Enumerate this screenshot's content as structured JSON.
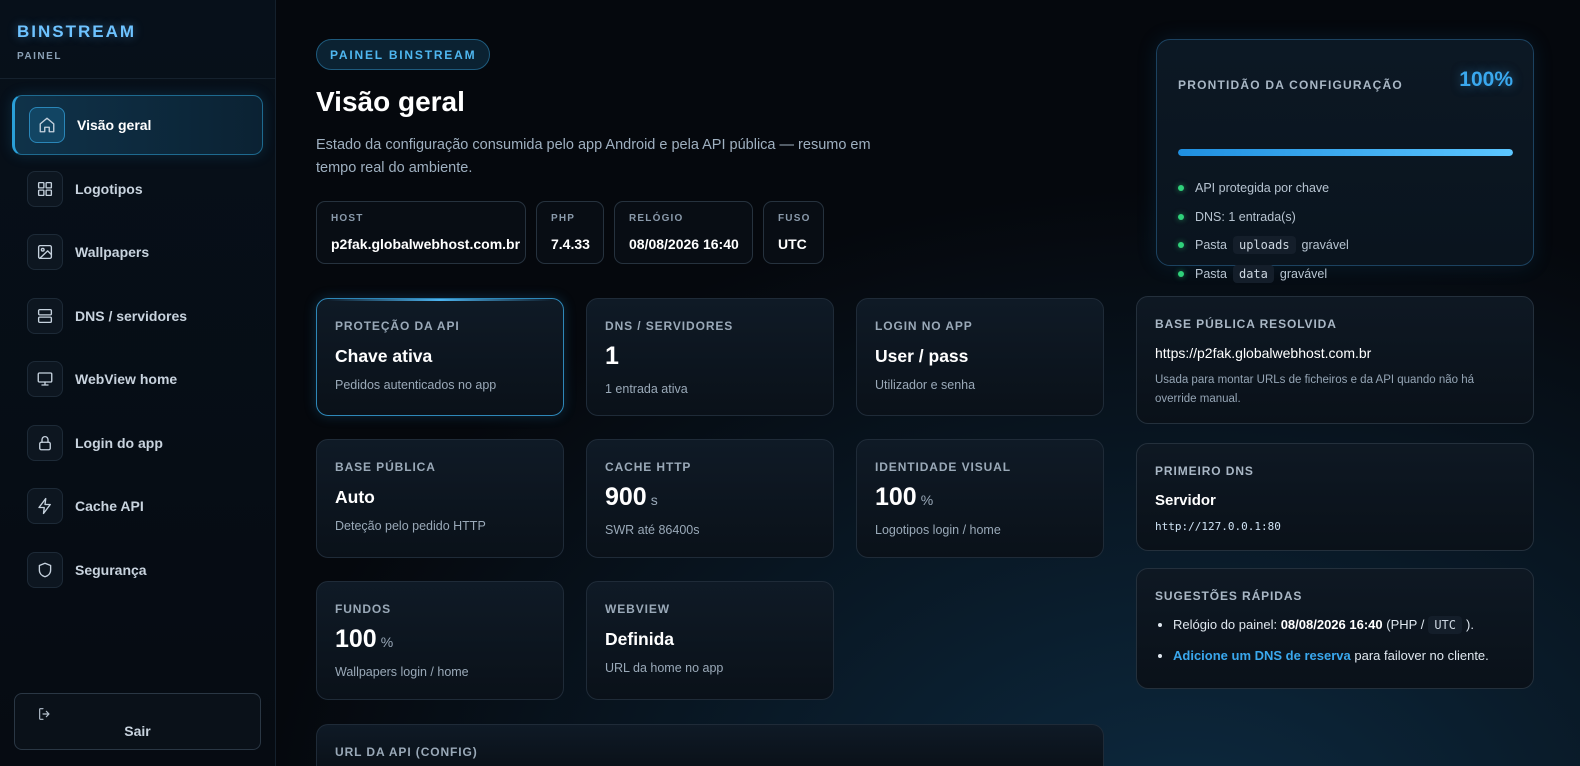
{
  "brand": {
    "title": "BINSTREAM",
    "subtitle": "PAINEL"
  },
  "sidebar": {
    "items": [
      {
        "label": "Visão geral",
        "icon": "home-icon",
        "active": true
      },
      {
        "label": "Logotipos",
        "icon": "grid-icon"
      },
      {
        "label": "Wallpapers",
        "icon": "image-icon"
      },
      {
        "label": "DNS / servidores",
        "icon": "server-icon"
      },
      {
        "label": "WebView home",
        "icon": "monitor-icon"
      },
      {
        "label": "Login do app",
        "icon": "lock-icon"
      },
      {
        "label": "Cache API",
        "icon": "zap-icon"
      },
      {
        "label": "Segurança",
        "icon": "shield-icon"
      }
    ],
    "logout_label": "Sair"
  },
  "header": {
    "badge": "PAINEL BINSTREAM",
    "title": "Visão geral",
    "description": "Estado da configuração consumida pelo app Android e pela API pública — resumo em tempo real do ambiente."
  },
  "meta": [
    {
      "key": "HOST",
      "value": "p2fak.globalwebhost.com.br"
    },
    {
      "key": "PHP",
      "value": "7.4.33"
    },
    {
      "key": "RELÓGIO",
      "value": "08/08/2026 16:40"
    },
    {
      "key": "FUSO",
      "value": "UTC"
    }
  ],
  "cards": [
    {
      "key": "PROTEÇÃO DA API",
      "value": "Chave ativa",
      "sub": "Pedidos autenticados no app"
    },
    {
      "key": "DNS / SERVIDORES",
      "value": "1",
      "sub": "1 entrada ativa"
    },
    {
      "key": "LOGIN NO APP",
      "value": "User / pass",
      "sub": "Utilizador e senha"
    },
    {
      "key": "BASE PÚBLICA",
      "value": "Auto",
      "sub": "Deteção pelo pedido HTTP"
    },
    {
      "key": "CACHE HTTP",
      "value": "900",
      "unit": "s",
      "sub": "SWR até 86400s"
    },
    {
      "key": "IDENTIDADE VISUAL",
      "value": "100",
      "unit": "%",
      "sub": "Logotipos login / home"
    },
    {
      "key": "FUNDOS",
      "value": "100",
      "unit": "%",
      "sub": "Wallpapers login / home"
    },
    {
      "key": "WEBVIEW",
      "value": "Definida",
      "sub": "URL da home no app"
    },
    {
      "key": "URL DA API (CONFIG)"
    }
  ],
  "readiness": {
    "title": "PRONTIDÃO DA CONFIGURAÇÃO",
    "percent": "100%",
    "progress": 1.0,
    "checks": [
      {
        "text": "API protegida por chave"
      },
      {
        "text": "DNS: 1 entrada(s)"
      },
      {
        "pre": "Pasta",
        "code": "uploads",
        "post": "gravável"
      },
      {
        "pre": "Pasta",
        "code": "data",
        "post": "gravável"
      }
    ]
  },
  "base_publica": {
    "title": "BASE PÚBLICA RESOLVIDA",
    "url": "https://p2fak.globalwebhost.com.br",
    "note": "Usada para montar URLs de ficheiros e da API quando não há override manual."
  },
  "primeiro_dns": {
    "title": "PRIMEIRO DNS",
    "name": "Servidor",
    "url": "http://127.0.0.1:80"
  },
  "sugestoes": {
    "title": "SUGESTÕES RÁPIDAS",
    "clock_label": "Relógio do painel:",
    "clock_value": "08/08/2026 16:40",
    "clock_paren_open": "(PHP /",
    "clock_tz": "UTC",
    "clock_paren_close": ").",
    "dns_link": "Adicione um DNS de reserva",
    "dns_rest": "para failover no cliente."
  },
  "colors": {
    "accent": "#3aa8ee",
    "ok": "#2fd17a",
    "background": "#05080d"
  }
}
